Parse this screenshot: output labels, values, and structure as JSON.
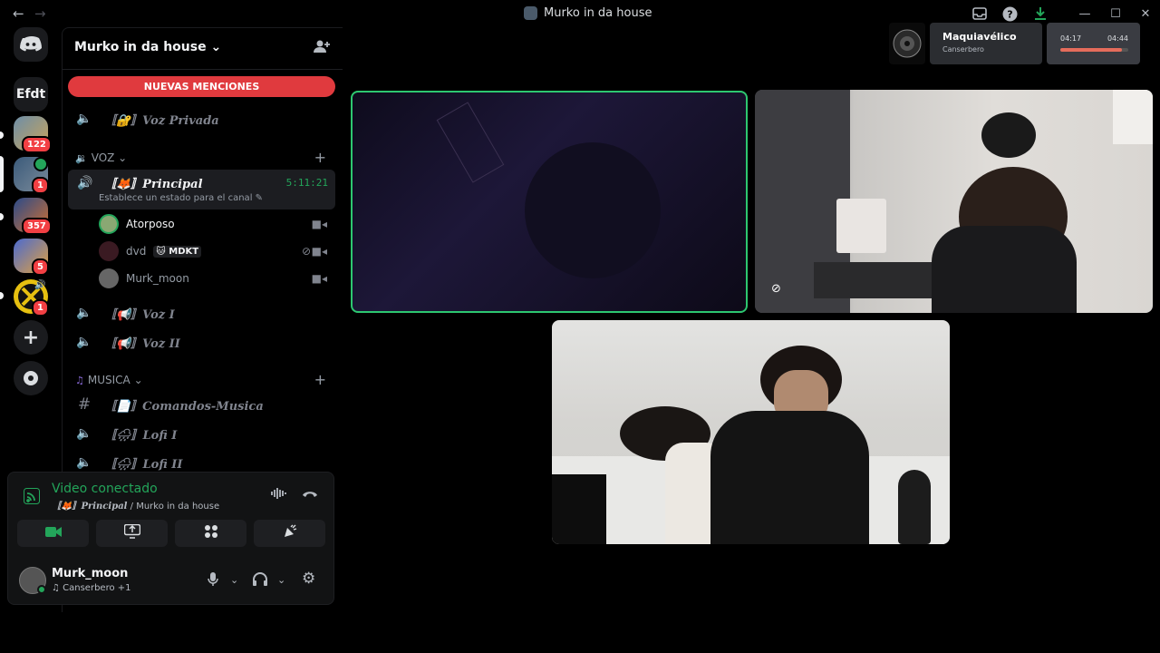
{
  "window": {
    "title": "Murko in da house"
  },
  "rail": {
    "text_server": "Efdt",
    "badges": [
      "122",
      "1",
      "357",
      "5",
      "1"
    ]
  },
  "guild": {
    "name": "Murko in da house ⌄"
  },
  "mentions_banner": "NUEVAS MENCIONES",
  "channels": {
    "private_voice": "〚🔐〛Voz Privada",
    "voice_category": "VOZ ⌄",
    "active": {
      "name": "〚🦊〛Principal",
      "timer": "5:11:21",
      "status": "Establece un estado para el canal ✎"
    },
    "users": [
      {
        "name": "Atorposo"
      },
      {
        "name": "dvd",
        "tag": "🐱 MDKT"
      },
      {
        "name": "Murk_moon"
      }
    ],
    "voz1": "〚📢〛Voz I",
    "voz2": "〚📢〛Voz II",
    "music_category": "MUSICA ⌄",
    "comandos": "〚📄〛Comandos-Musica",
    "lofi1": "〚🌧〛Lofi I",
    "lofi2": "〚🌧〛Lofi II"
  },
  "voice_panel": {
    "title": "Video conectado",
    "channel": "〚🦊〛Principal",
    "server": " / Murko in da house"
  },
  "me": {
    "name": "Murk_moon",
    "status": "♫ Canserbero +1"
  },
  "now_playing": {
    "title": "Maquiavélico",
    "artist": "Canserbero",
    "elapsed": "04:17",
    "total": "04:44",
    "progress": 0.9
  },
  "colors": {
    "accent_green": "#23a55a",
    "mention_red": "#e03a3e",
    "badge_red": "#f23f43"
  }
}
